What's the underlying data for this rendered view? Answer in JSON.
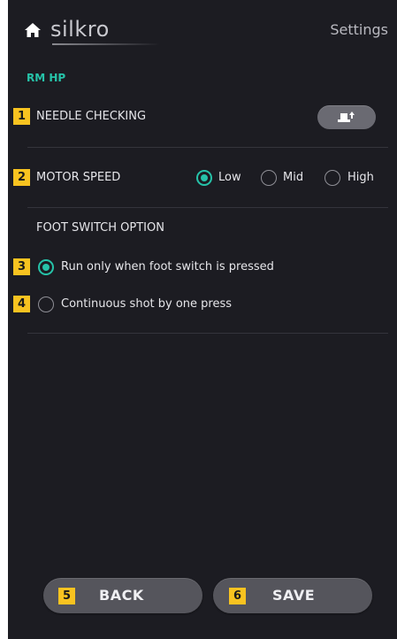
{
  "header": {
    "logo_text": "silkro",
    "title": "Settings",
    "home_icon": "home-icon"
  },
  "section": {
    "label": "RM HP"
  },
  "needle": {
    "badge": "1",
    "label": "NEEDLE CHECKING",
    "button_icon": "needle-up-icon"
  },
  "motor": {
    "badge": "2",
    "label": "MOTOR SPEED",
    "options": [
      "Low",
      "Mid",
      "High"
    ],
    "selected": "Low"
  },
  "foot": {
    "heading": "FOOT SWITCH OPTION",
    "options": [
      {
        "badge": "3",
        "label": "Run only when foot switch is pressed",
        "checked": true
      },
      {
        "badge": "4",
        "label": "Continuous shot by one press",
        "checked": false
      }
    ]
  },
  "buttons": {
    "back": {
      "badge": "5",
      "label": "BACK"
    },
    "save": {
      "badge": "6",
      "label": "SAVE"
    }
  },
  "colors": {
    "accent": "#26c3a9",
    "badge": "#f8c320",
    "background": "#1c1c22"
  }
}
